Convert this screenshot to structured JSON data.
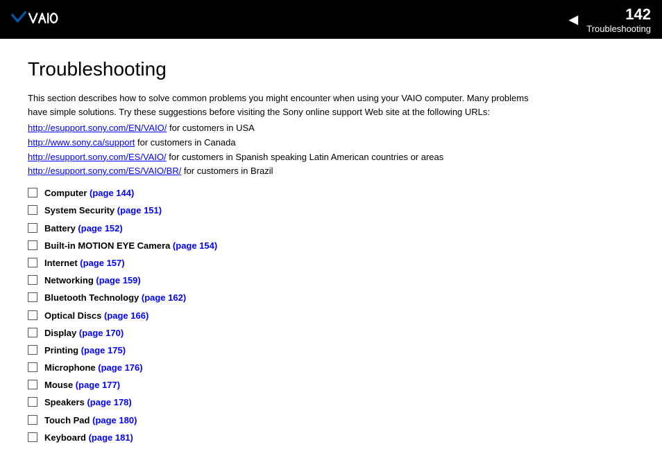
{
  "header": {
    "page_number": "142",
    "arrow": "◄",
    "section_label": "Troubleshooting",
    "logo_alt": "VAIO"
  },
  "page_title": "Troubleshooting",
  "intro": {
    "line1": "This section describes how to solve common problems you might encounter when using your VAIO computer. Many problems",
    "line2": "have simple solutions. Try these suggestions before visiting the Sony online support Web site at the following URLs:"
  },
  "urls": [
    {
      "url": "http://esupport.sony.com/EN/VAIO/",
      "suffix": " for customers in USA"
    },
    {
      "url": "http://www.sony.ca/support",
      "suffix": " for customers in Canada"
    },
    {
      "url": "http://esupport.sony.com/ES/VAIO/",
      "suffix": " for customers in Spanish speaking Latin American countries or areas"
    },
    {
      "url": "http://esupport.sony.com/ES/VAIO/BR/",
      "suffix": " for customers in Brazil"
    }
  ],
  "items": [
    {
      "label": "Computer",
      "link_text": "(page 144)"
    },
    {
      "label": "System Security",
      "link_text": "(page 151)"
    },
    {
      "label": "Battery",
      "link_text": "(page 152)"
    },
    {
      "label": "Built-in MOTION EYE Camera",
      "link_text": "(page 154)"
    },
    {
      "label": "Internet",
      "link_text": "(page 157)"
    },
    {
      "label": "Networking",
      "link_text": "(page 159)"
    },
    {
      "label": "Bluetooth Technology",
      "link_text": "(page 162)"
    },
    {
      "label": "Optical Discs",
      "link_text": "(page 166)"
    },
    {
      "label": "Display",
      "link_text": "(page 170)"
    },
    {
      "label": "Printing",
      "link_text": "(page 175)"
    },
    {
      "label": "Microphone",
      "link_text": "(page 176)"
    },
    {
      "label": "Mouse",
      "link_text": "(page 177)"
    },
    {
      "label": "Speakers",
      "link_text": "(page 178)"
    },
    {
      "label": "Touch Pad",
      "link_text": "(page 180)"
    },
    {
      "label": "Keyboard",
      "link_text": "(page 181)"
    }
  ]
}
